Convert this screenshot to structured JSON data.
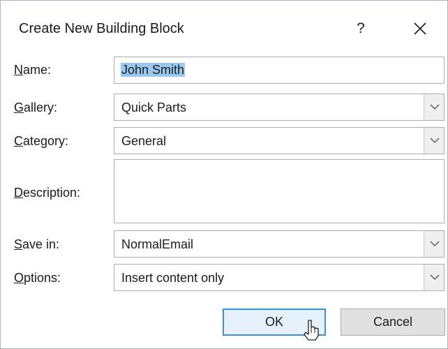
{
  "dialog": {
    "title": "Create New Building Block",
    "help_label": "?"
  },
  "fields": {
    "name": {
      "label_accel": "N",
      "label_rest": "ame:",
      "value": "John Smith"
    },
    "gallery": {
      "label_accel": "G",
      "label_rest": "allery:",
      "value": "Quick Parts"
    },
    "category": {
      "label_accel": "C",
      "label_rest": "ategory:",
      "value": "General"
    },
    "description": {
      "label_accel": "D",
      "label_rest": "escription:",
      "value": ""
    },
    "save_in": {
      "label_accel": "S",
      "label_rest": "ave in:",
      "value": "NormalEmail"
    },
    "options": {
      "label_accel": "O",
      "label_rest": "ptions:",
      "value": "Insert content only"
    }
  },
  "buttons": {
    "ok": "OK",
    "cancel": "Cancel"
  },
  "icons": {
    "close": "close-icon",
    "dropdown": "chevron-down-icon",
    "cursor": "mouse-pointer-icon"
  }
}
